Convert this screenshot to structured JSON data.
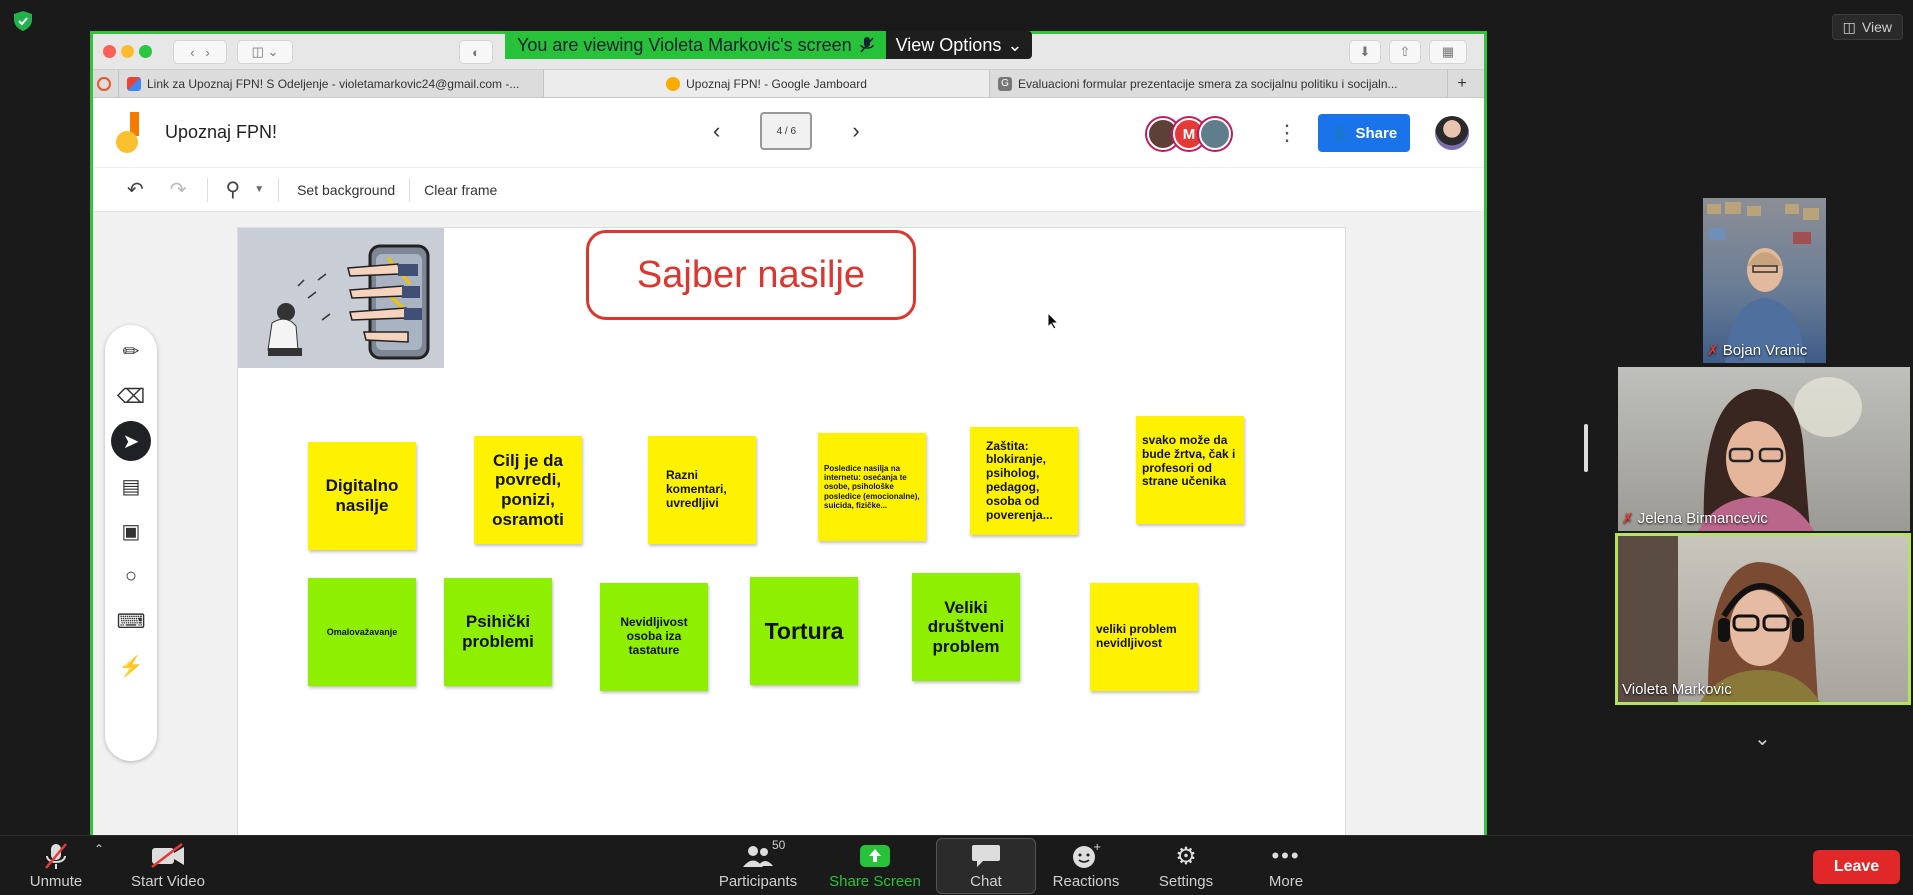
{
  "zoom": {
    "view_label": "View",
    "banner_text": "You are viewing Violeta Markovic's screen",
    "view_options_label": "View Options",
    "participants": [
      {
        "name": "Bojan Vranic",
        "muted": true
      },
      {
        "name": "Jelena Birmancevic",
        "muted": true
      },
      {
        "name": "Violeta Markovic",
        "muted": false,
        "active_speaker": true
      }
    ],
    "toolbar": {
      "unmute": "Unmute",
      "start_video": "Start Video",
      "participants": "Participants",
      "participant_count": "50",
      "share_screen": "Share Screen",
      "chat": "Chat",
      "reactions": "Reactions",
      "settings": "Settings",
      "more": "More",
      "leave": "Leave"
    },
    "colors": {
      "share_green": "#28c23a",
      "leave_red": "#e02828"
    }
  },
  "browser": {
    "tabs": [
      {
        "title": "Link za Upoznaj FPN! S Odeljenje - violetamarkovic24@gmail.com -..."
      },
      {
        "title": "Upoznaj FPN! - Google Jamboard",
        "active": true
      },
      {
        "title": "Evaluacioni formular prezentacije smera za socijalnu politiku i socijaln..."
      }
    ]
  },
  "jamboard": {
    "title": "Upoznaj FPN!",
    "frame_indicator": "4 / 6",
    "avatar_letter": "M",
    "share_label": "Share",
    "toolbar": {
      "set_background": "Set background",
      "clear_frame": "Clear frame"
    },
    "board_title": "Sajber nasilje",
    "notes_row1": [
      {
        "text": "Digitalno nasilje",
        "color": "yellow"
      },
      {
        "text": "Cilj je da povredi, ponizi, osramoti",
        "color": "yellow"
      },
      {
        "text": "Razni komentari, uvredljivi",
        "color": "yellow"
      },
      {
        "text": "Posledice nasilja na internetu: osećanja te osobe, psihološke posledice (emocionalne), suicida, fizičke...",
        "color": "yellow"
      },
      {
        "text": "Zaštita: blokiranje, psiholog, pedagog, osoba od poverenja...",
        "color": "yellow"
      },
      {
        "text": "svako može da bude žrtva, čak i profesori od strane učenika",
        "color": "yellow"
      }
    ],
    "notes_row2": [
      {
        "text": "Omalovažavanje",
        "color": "green"
      },
      {
        "text": "Psihički problemi",
        "color": "green"
      },
      {
        "text": "Nevidljivost osoba iza tastature",
        "color": "green"
      },
      {
        "text": "Tortura",
        "color": "green"
      },
      {
        "text": "Veliki društveni problem",
        "color": "green"
      },
      {
        "text": "veliki problem nevidljivost",
        "color": "yellow"
      }
    ]
  }
}
